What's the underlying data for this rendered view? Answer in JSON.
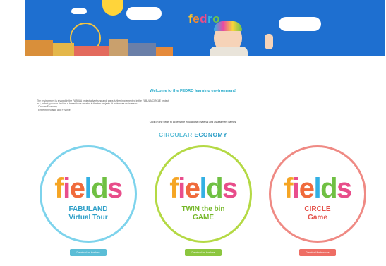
{
  "banner": {
    "logo_text": "fedro",
    "logo_colors": [
      "#f6c02f",
      "#f28a2f",
      "#e84d8a",
      "#2fb6e5",
      "#6fc24a"
    ]
  },
  "welcome_title": "Welcome to the FEDRO learning environment!",
  "intro_lines": [
    "The environment is shaped in the FABULA project advertising and, ways further implemented in the FABULA CIRCLE project.",
    "In it, in fact, you can find the e-based tools created in the two projects. It addresses main areas:",
    "- Circular Economy",
    "- Entrepreneurship and Finance"
  ],
  "click_line": "Click on the fields to access the educational material and assessment games.",
  "section": {
    "word1": "CIRCULAR",
    "word2": "ECONOMY"
  },
  "fields_letters": [
    "f",
    "i",
    "e",
    "l",
    "d",
    "s"
  ],
  "fields_colors": [
    "#f5a524",
    "#e94e8d",
    "#f06a3b",
    "#33b0e3",
    "#70c043",
    "#e84d8a"
  ],
  "cards": [
    {
      "line1": "FABULAND",
      "line2": "Virtual Tour",
      "ring": "#7dd3ec",
      "text": "#2e9fc8",
      "button": "Download the brochure",
      "button_color": "#5bbdd6"
    },
    {
      "line1": "TWIN the bin",
      "line2": "GAME",
      "ring": "#b4d944",
      "text": "#76b82a",
      "button": "Download the brochure",
      "button_color": "#8cc63f"
    },
    {
      "line1": "CIRCLE",
      "line2": "Game",
      "ring": "#ef8a84",
      "text": "#e4544c",
      "button": "Download the brochure",
      "button_color": "#ee6d64"
    }
  ]
}
